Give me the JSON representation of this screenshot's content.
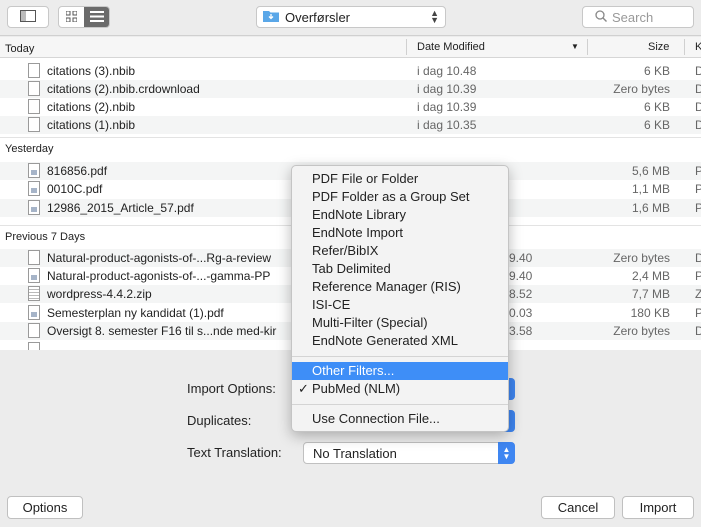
{
  "toolbar": {
    "location": "Overførsler",
    "search_placeholder": "Search"
  },
  "columns": {
    "name": "",
    "date": "Date Modified",
    "size": "Size",
    "kind": "K"
  },
  "sections": {
    "today": {
      "title": "Today",
      "files": [
        {
          "name": "citations (3).nbib",
          "date": "i dag 10.48",
          "size": "6 KB",
          "kind": "D"
        },
        {
          "name": "citations (2).nbib.crdownload",
          "date": "i dag 10.39",
          "size": "Zero bytes",
          "kind": "D"
        },
        {
          "name": "citations (2).nbib",
          "date": "i dag 10.39",
          "size": "6 KB",
          "kind": "D"
        },
        {
          "name": "citations (1).nbib",
          "date": "i dag 10.35",
          "size": "6 KB",
          "kind": "D"
        }
      ]
    },
    "yesterday": {
      "title": "Yesterday",
      "files": [
        {
          "name": "816856.pdf",
          "date": "",
          "size": "5,6 MB",
          "kind": "P"
        },
        {
          "name": "0010C.pdf",
          "date": "",
          "size": "1,1 MB",
          "kind": "P"
        },
        {
          "name": "12986_2015_Article_57.pdf",
          "date": "",
          "size": "1,6 MB",
          "kind": "P"
        }
      ]
    },
    "previous": {
      "title": "Previous 7 Days",
      "files": [
        {
          "name": "Natural-product-agonists-of-...Rg-a-review",
          "date": "9.40",
          "size": "Zero bytes",
          "kind": "D"
        },
        {
          "name": "Natural-product-agonists-of-...-gamma-PP",
          "date": "9.40",
          "size": "2,4 MB",
          "kind": "P"
        },
        {
          "name": "wordpress-4.4.2.zip",
          "date": "8.52",
          "size": "7,7 MB",
          "kind": "Z"
        },
        {
          "name": "Semesterplan ny kandidat (1).pdf",
          "date": "0.03",
          "size": "180 KB",
          "kind": "P"
        },
        {
          "name": "Oversigt 8. semester F16 til s...nde med-kir",
          "date": "3.58",
          "size": "Zero bytes",
          "kind": "D"
        }
      ]
    }
  },
  "options": {
    "import_label": "Import Options:",
    "duplicates_label": "Duplicates:",
    "translation_label": "Text Translation:",
    "translation_value": "No Translation"
  },
  "menu": {
    "items": [
      "PDF File or Folder",
      "PDF Folder as a Group Set",
      "EndNote Library",
      "EndNote Import",
      "Refer/BibIX",
      "Tab Delimited",
      "Reference Manager (RIS)",
      "ISI-CE",
      "Multi-Filter (Special)",
      "EndNote Generated XML"
    ],
    "other_filters": "Other Filters...",
    "checked_item": "PubMed (NLM)",
    "check_mark": "✓",
    "connection_file": "Use Connection File..."
  },
  "buttons": {
    "options": "Options",
    "cancel": "Cancel",
    "import": "Import"
  },
  "colors": {
    "accent": "#3f86f1",
    "highlight": "#3e8ef7"
  }
}
